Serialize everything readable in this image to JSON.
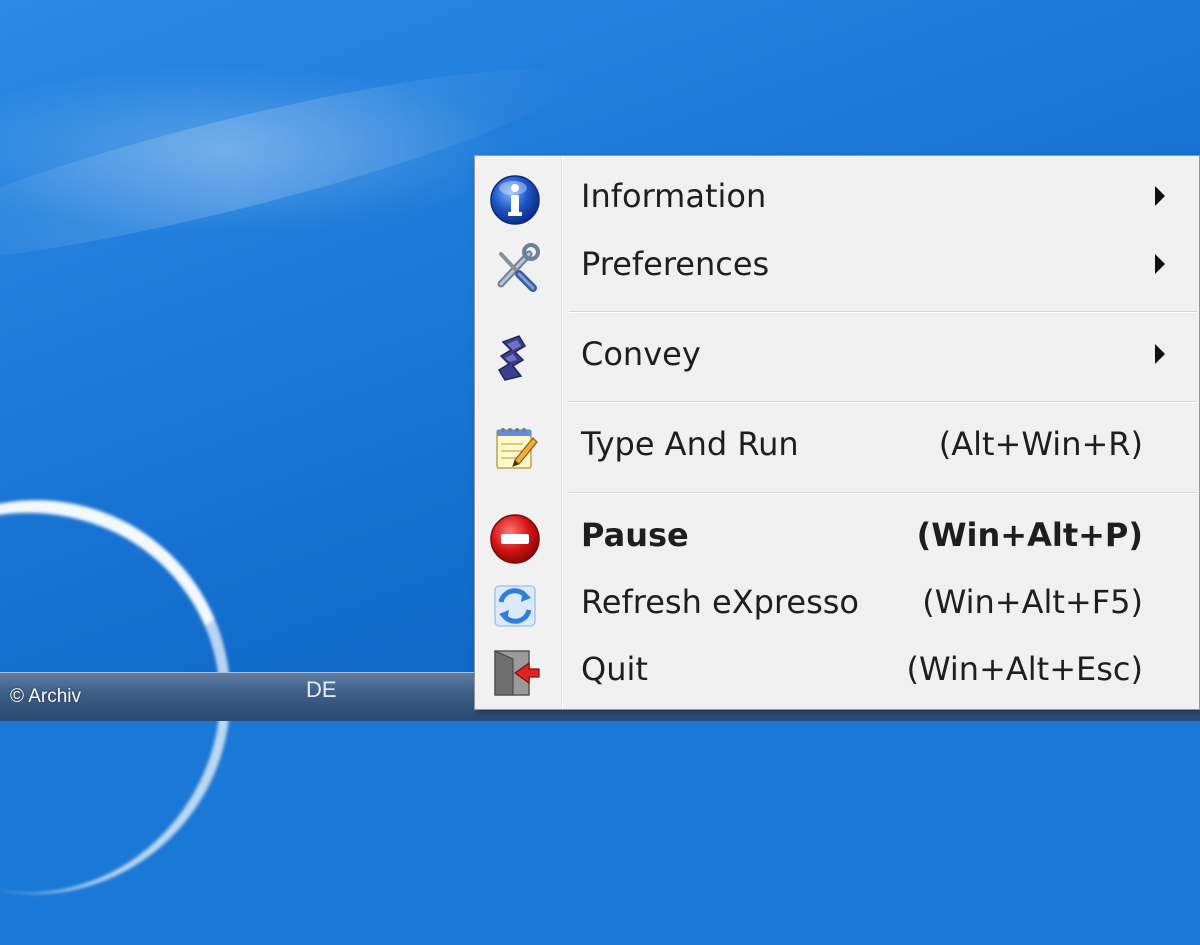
{
  "menu": {
    "items": [
      {
        "label": "Information",
        "shortcut": "",
        "icon": "info-icon",
        "submenu": true,
        "bold": false
      },
      {
        "label": "Preferences",
        "shortcut": "",
        "icon": "tools-icon",
        "submenu": true,
        "bold": false
      },
      {
        "label": "Convey",
        "shortcut": "",
        "icon": "convey-icon",
        "submenu": true,
        "bold": false
      },
      {
        "label": "Type And Run",
        "shortcut": "(Alt+Win+R)",
        "icon": "notepad-icon",
        "submenu": false,
        "bold": false
      },
      {
        "label": "Pause",
        "shortcut": "(Win+Alt+P)",
        "icon": "stop-icon",
        "submenu": false,
        "bold": true
      },
      {
        "label": "Refresh eXpresso",
        "shortcut": "(Win+Alt+F5)",
        "icon": "refresh-icon",
        "submenu": false,
        "bold": false
      },
      {
        "label": "Quit",
        "shortcut": "(Win+Alt+Esc)",
        "icon": "exit-icon",
        "submenu": false,
        "bold": false
      }
    ]
  },
  "taskbar": {
    "language": "DE"
  },
  "watermark": "© Archiv",
  "colors": {
    "menu_bg": "#f0f0f0",
    "desktop": "#1a78d6",
    "info_blue": "#1d4fb8",
    "stop_red": "#d01818"
  }
}
